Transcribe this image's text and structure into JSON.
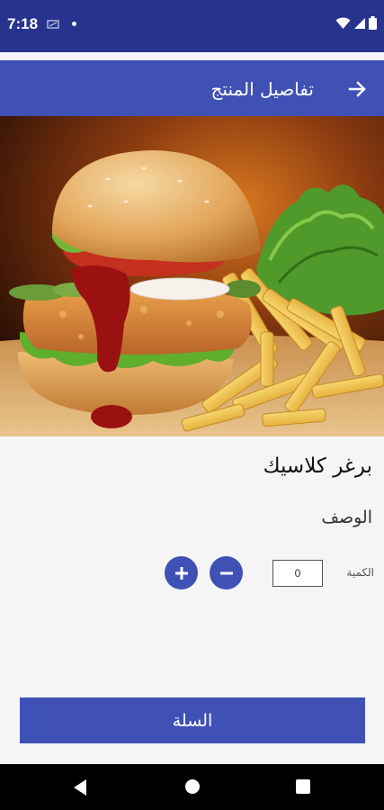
{
  "status_bar": {
    "time": "7:18",
    "icons": [
      "sim-icon",
      "notification-dot-icon",
      "wifi-icon",
      "signal-icon",
      "battery-icon"
    ]
  },
  "app_bar": {
    "title": "تفاصيل المنتج",
    "back_icon": "arrow-right-icon"
  },
  "product": {
    "image": "burger-with-fries-photo",
    "name": "برغر كلاسيك",
    "description_label": "الوصف"
  },
  "quantity": {
    "label": "الكمية",
    "value": "0",
    "increment_icon": "plus-icon",
    "decrement_icon": "minus-icon"
  },
  "cart_button": {
    "label": "السلة"
  },
  "nav_bar": {
    "icons": [
      "back-triangle-icon",
      "home-circle-icon",
      "recents-square-icon"
    ]
  },
  "colors": {
    "status_bar": "#26348e",
    "primary": "#3f51b5",
    "background": "#f5f5f5"
  }
}
